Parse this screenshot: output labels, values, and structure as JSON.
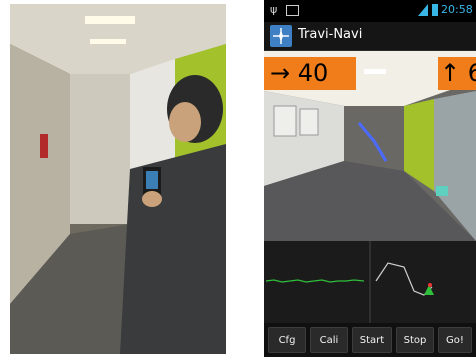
{
  "status_bar": {
    "time": "20:58",
    "signal_label": "H"
  },
  "app": {
    "title": "Travi-Navi"
  },
  "guidance": {
    "distance": "→ 40",
    "turn": "↑ 6"
  },
  "buttons": [
    {
      "label": "Cfg"
    },
    {
      "label": "Cali"
    },
    {
      "label": "Start"
    },
    {
      "label": "Stop"
    },
    {
      "label": "Go!"
    }
  ],
  "colors": {
    "accent_orange": "#f07d1a",
    "status_blue": "#38b6e6",
    "wall_green": "#a3c12a",
    "trace_green": "#2fbf3a",
    "path_gray": "#cfcfcf"
  },
  "icons": {
    "app": "compass-icon",
    "status_left": [
      "usb-icon",
      "image-icon"
    ],
    "status_right": [
      "signal-icon",
      "battery-icon"
    ]
  }
}
